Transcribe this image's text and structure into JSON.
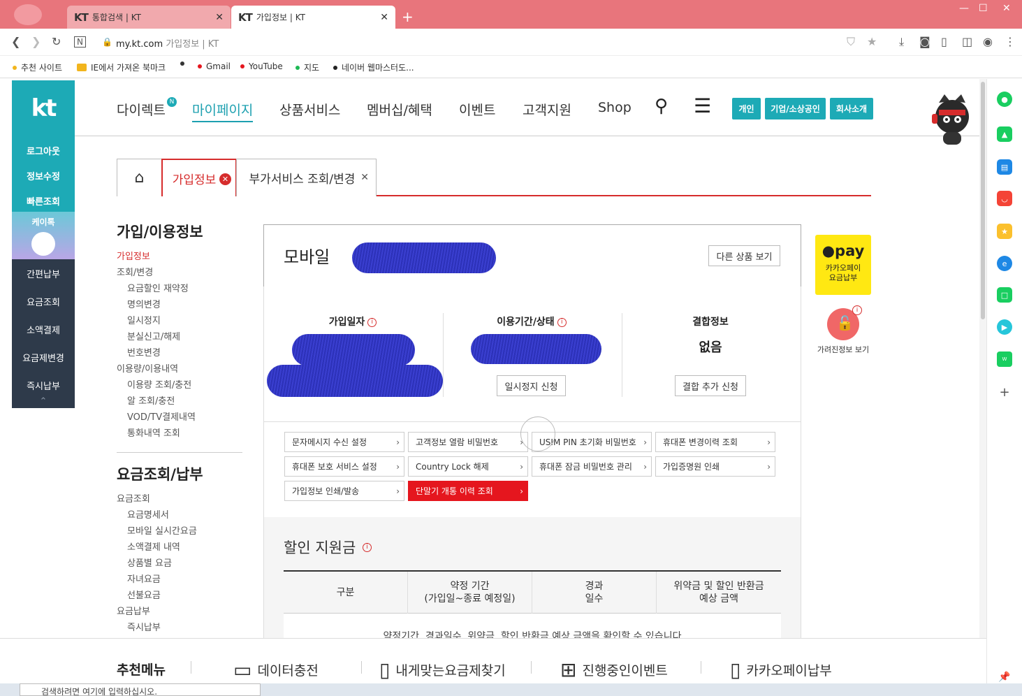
{
  "browser": {
    "tabs": [
      {
        "title": "통합검색 | KT",
        "favicon": "KT"
      },
      {
        "title": "가입정보 | KT",
        "favicon": "KT"
      }
    ],
    "new_tab": "+",
    "url_host": "my.kt.com",
    "url_rest": "가입정보 | KT",
    "bookmarks": [
      {
        "label": "추천 사이트",
        "color": "#f2b51d"
      },
      {
        "label": "IE에서 가져온 북마크",
        "color": "#f2b51d"
      },
      {
        "label": "Gmail",
        "color": "#e5161e"
      },
      {
        "label": "YouTube",
        "color": "#e5161e"
      },
      {
        "label": "지도",
        "color": "#1db954"
      },
      {
        "label": "네이버 웹마스터도...",
        "color": "#222222"
      }
    ]
  },
  "kt": {
    "logo": "kt",
    "left_top": [
      "로그아웃",
      "정보수정",
      "빠른조회"
    ],
    "katalk": "케이톡",
    "left_bottom": [
      "간편납부",
      "요금조회",
      "소액결제",
      "요금제변경",
      "즉시납부"
    ],
    "gnb": {
      "items": [
        "다이렉트",
        "마이페이지",
        "상품서비스",
        "멤버십/혜택",
        "이벤트",
        "고객지원",
        "Shop"
      ],
      "direct_badge": "N",
      "buttons": [
        "개인",
        "기업/소상공인",
        "회사소개"
      ]
    },
    "tabs": {
      "active": "가입정보",
      "second": "부가서비스 조회/변경"
    },
    "left_menu": {
      "section1": "가입/이용정보",
      "items1": [
        {
          "label": "가입정보",
          "level": 1,
          "active": true
        },
        {
          "label": "조회/변경",
          "level": 1
        },
        {
          "label": "요금할인 재약정",
          "level": 2
        },
        {
          "label": "명의변경",
          "level": 2
        },
        {
          "label": "일시정지",
          "level": 2
        },
        {
          "label": "분실신고/해제",
          "level": 2
        },
        {
          "label": "번호변경",
          "level": 2
        },
        {
          "label": "이용량/이용내역",
          "level": 1
        },
        {
          "label": "이용량 조회/충전",
          "level": 2
        },
        {
          "label": "알 조회/충전",
          "level": 2
        },
        {
          "label": "VOD/TV결제내역",
          "level": 2
        },
        {
          "label": "통화내역 조회",
          "level": 2
        }
      ],
      "section2": "요금조회/납부",
      "items2": [
        {
          "label": "요금조회",
          "level": 1
        },
        {
          "label": "요금명세서",
          "level": 2
        },
        {
          "label": "모바일 실시간요금",
          "level": 2
        },
        {
          "label": "소액결제 내역",
          "level": 2
        },
        {
          "label": "상품별 요금",
          "level": 2
        },
        {
          "label": "자녀요금",
          "level": 2
        },
        {
          "label": "선불요금",
          "level": 2
        },
        {
          "label": "요금납부",
          "level": 1
        },
        {
          "label": "즉시납부",
          "level": 2
        }
      ]
    },
    "main": {
      "product": "모바일",
      "other_product_btn": "다른 상품 보기",
      "col1": "가입일자",
      "col2": "이용기간/상태",
      "col3": "결합정보",
      "combo_value": "없음",
      "pause_btn": "일시정지 신청",
      "combo_btn": "결합 추가 신청",
      "links": [
        {
          "label": "문자메시지 수신 설정"
        },
        {
          "label": "고객정보 열람 비밀번호"
        },
        {
          "label": "USIM PIN 초기화 비밀번호"
        },
        {
          "label": "휴대폰 변경이력 조회"
        },
        {
          "label": "휴대폰 보호 서비스 설정"
        },
        {
          "label": "Country Lock 해제"
        },
        {
          "label": "휴대폰 잠금 비밀번호 관리"
        },
        {
          "label": "가입증명원 인쇄"
        },
        {
          "label": "가입정보 인쇄/발송"
        },
        {
          "label": "단말기 개통 이력 조회",
          "highlight": true
        }
      ],
      "discount_title": "할인 지원금",
      "table_headers": [
        "구분",
        "약정 기간\n(가입일~종료 예정일)",
        "경과\n일수",
        "위약금 및 할인 반환금\n예상 금액"
      ],
      "table_note": "약정기간, 경과일수, 위약금, 할인 반환금 예상 금액을 확인할 수 있습니다"
    },
    "promo": {
      "kakaopay_logo": "pay",
      "kakaopay_text": "카카오페이 요금납부",
      "lock_text": "가려진정보 보기"
    },
    "bottom": {
      "title": "추천메뉴",
      "items": [
        "데이터충전",
        "내게맞는요금제찾기",
        "진행중인이벤트",
        "카카오페이납부"
      ]
    }
  },
  "taskbar": {
    "search_placeholder": "검색하려면 여기에 입력하십시오."
  },
  "colors": {
    "brand": "#1daab6",
    "accent": "#d62c2c",
    "tabbar": "#e8757c",
    "navy": "#2e3a4a",
    "kakao": "#ffe812"
  }
}
